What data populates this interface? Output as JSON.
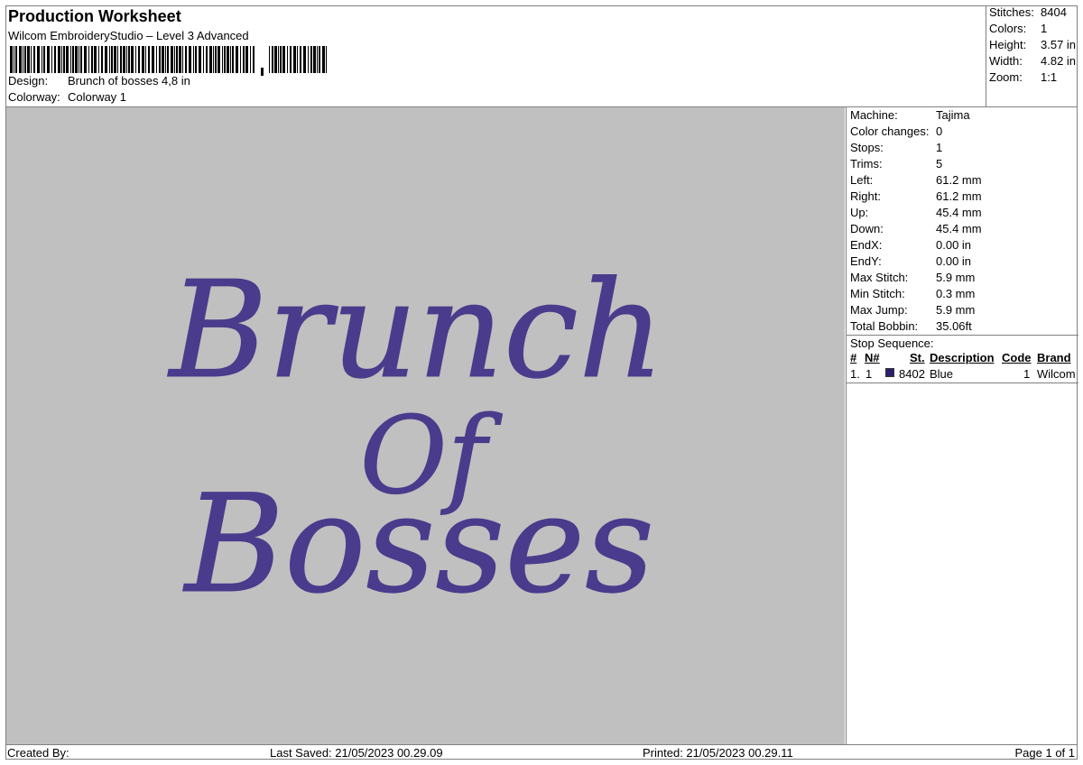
{
  "header": {
    "title": "Production Worksheet",
    "software": "Wilcom EmbroideryStudio – Level 3 Advanced",
    "design_label": "Design:",
    "design_value": "Brunch of bosses 4,8 in",
    "colorway_label": "Colorway:",
    "colorway_value": "Colorway 1"
  },
  "summary": [
    {
      "label": "Stitches:",
      "value": "8404"
    },
    {
      "label": "Colors:",
      "value": "1"
    },
    {
      "label": "Height:",
      "value": "3.57 in"
    },
    {
      "label": "Width:",
      "value": "4.82 in"
    },
    {
      "label": "Zoom:",
      "value": "1:1"
    }
  ],
  "properties": [
    {
      "label": "Machine:",
      "value": "Tajima"
    },
    {
      "label": "Color changes:",
      "value": "0"
    },
    {
      "label": "Stops:",
      "value": "1"
    },
    {
      "label": "Trims:",
      "value": "5"
    },
    {
      "label": "Left:",
      "value": "61.2 mm"
    },
    {
      "label": "Right:",
      "value": "61.2 mm"
    },
    {
      "label": "Up:",
      "value": "45.4 mm"
    },
    {
      "label": "Down:",
      "value": "45.4 mm"
    },
    {
      "label": "EndX:",
      "value": "0.00 in"
    },
    {
      "label": "EndY:",
      "value": "0.00 in"
    },
    {
      "label": "Max Stitch:",
      "value": "5.9 mm"
    },
    {
      "label": "Min Stitch:",
      "value": "0.3 mm"
    },
    {
      "label": "Max Jump:",
      "value": "5.9 mm"
    },
    {
      "label": "Total Bobbin:",
      "value": "35.06ft"
    }
  ],
  "stop_sequence": {
    "title": "Stop Sequence:",
    "columns": [
      "#",
      "N#",
      "St.",
      "Description",
      "Code",
      "Brand"
    ],
    "rows": [
      {
        "index": "1.",
        "needle": "1",
        "stitches": "8402",
        "description": "Blue",
        "code": "1",
        "brand": "Wilcom",
        "color": "#2b1f6e"
      }
    ]
  },
  "design_text": {
    "line1": "Brunch",
    "line2": "Of",
    "line3": "Bosses",
    "thread_color": "#4b3b8c",
    "background": "#c0c0c0"
  },
  "footer": {
    "created_by": "Created By:",
    "last_saved": "Last Saved: 21/05/2023 00.29.09",
    "printed": "Printed: 21/05/2023 00.29.11",
    "page": "Page 1 of 1"
  }
}
